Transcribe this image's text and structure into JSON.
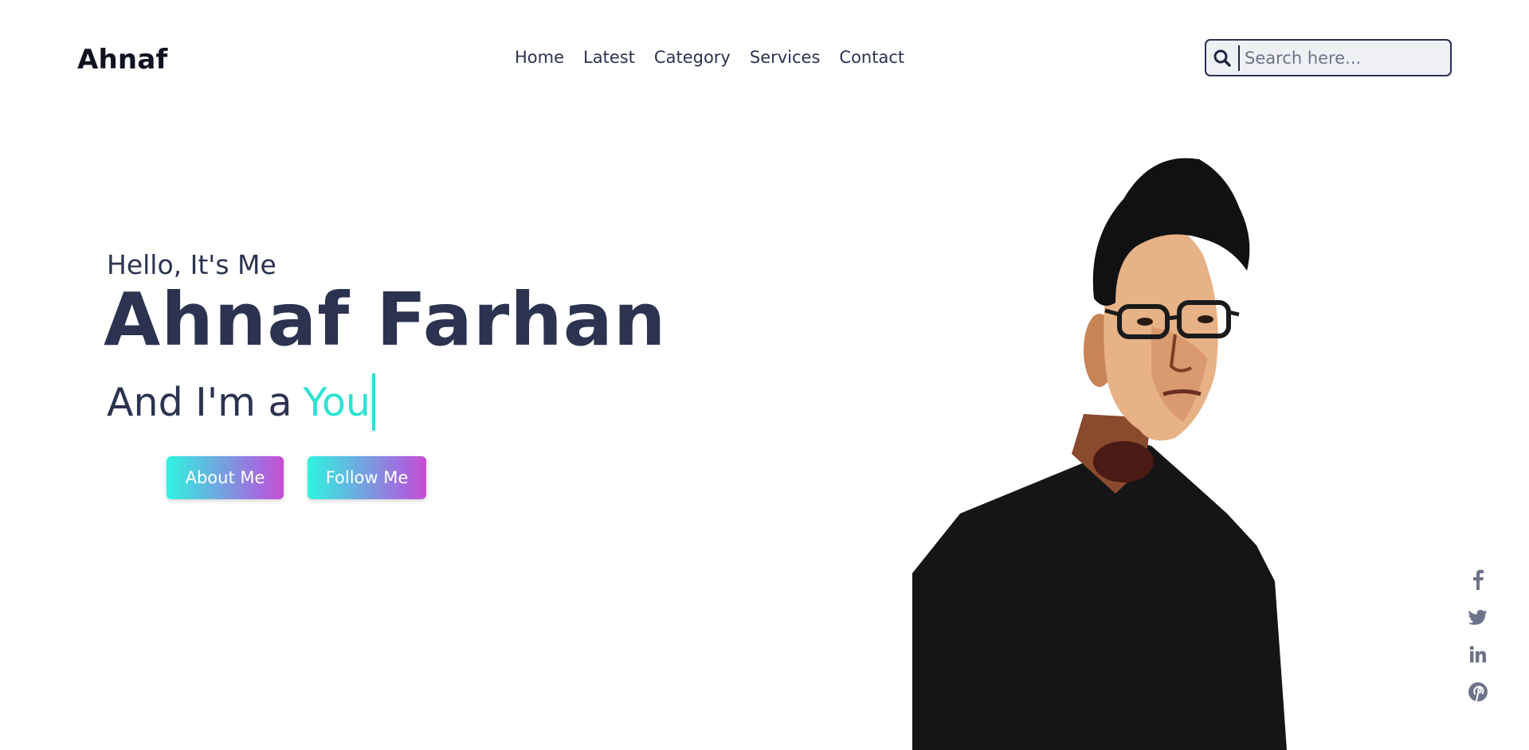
{
  "header": {
    "logo": "Ahnaf",
    "nav": [
      "Home",
      "Latest",
      "Category",
      "Services",
      "Contact"
    ],
    "search": {
      "placeholder": "Search here...",
      "value": "",
      "icon": "search-icon"
    }
  },
  "hero": {
    "greeting": "Hello, It's Me",
    "name": "Ahnaf Farhan",
    "role_prefix": "And I'm a",
    "role_typed": "You",
    "buttons": {
      "about": "About Me",
      "follow": "Follow Me"
    },
    "portrait": "portrait-photo"
  },
  "social": [
    "facebook-icon",
    "twitter-icon",
    "linkedin-icon",
    "pinterest-icon"
  ],
  "colors": {
    "text": "#2b3350",
    "accent": "#2fe2d2",
    "button_gradient_start": "#2ff3e0",
    "button_gradient_end": "#c94ed0",
    "social_icon": "#6d7389"
  }
}
